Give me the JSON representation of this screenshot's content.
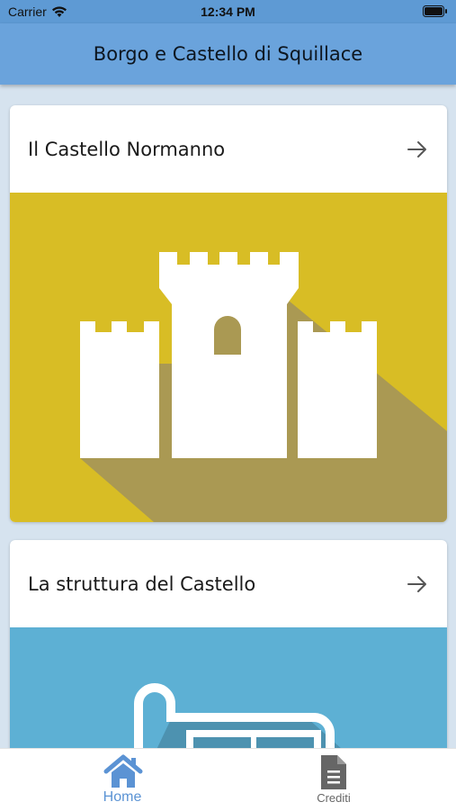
{
  "status_bar": {
    "carrier": "Carrier",
    "time": "12:34 PM"
  },
  "nav": {
    "title": "Borgo e Castello di Squillace"
  },
  "cards": [
    {
      "title": "Il Castello Normanno",
      "image_bg": "#d8bd25"
    },
    {
      "title": "La struttura del Castello",
      "image_bg": "#5db0d4"
    }
  ],
  "tabs": [
    {
      "label": "Home",
      "icon": "home-icon",
      "active": true,
      "color": "#5b93d4"
    },
    {
      "label": "Crediti",
      "icon": "document-icon",
      "active": false,
      "color": "#666666"
    }
  ]
}
